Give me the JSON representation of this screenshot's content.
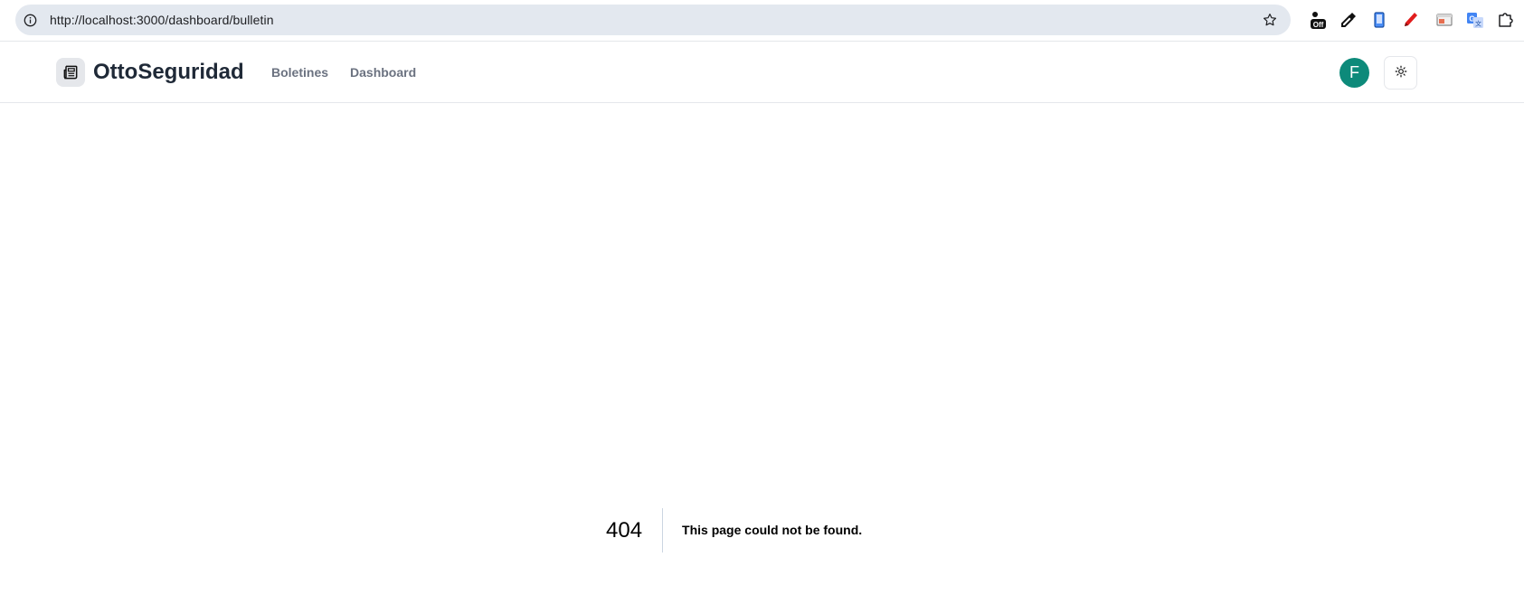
{
  "browser": {
    "url": "http://localhost:3000/dashboard/bulletin",
    "extensions": [
      "off-badge-extension-icon",
      "eyedropper-icon",
      "phone-extension-icon",
      "red-pen-icon",
      "window-capture-icon",
      "translate-icon",
      "puzzle-piece-icon"
    ],
    "off_badge_label": "Off"
  },
  "app": {
    "brand_name": "OttoSeguridad",
    "nav": [
      {
        "label": "Boletines"
      },
      {
        "label": "Dashboard"
      }
    ],
    "avatar_initial": "F",
    "accent_color": "#0d8a7a"
  },
  "not_found": {
    "code": "404",
    "message": "This page could not be found."
  }
}
